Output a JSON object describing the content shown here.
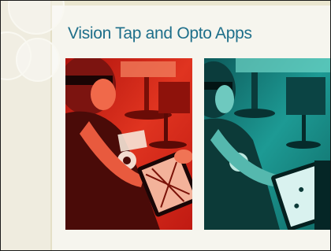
{
  "slide": {
    "title": "Vision Tap and Opto Apps"
  },
  "photos": [
    {
      "id": "left",
      "description_tint": "red"
    },
    {
      "id": "right",
      "description_tint": "teal"
    }
  ],
  "colors": {
    "title": "#1e6f8a",
    "background": "#f6f5ee",
    "left_rail": "#efecdf",
    "red_tint": "#d8231a",
    "teal_tint": "#168a8a"
  },
  "icons": [
    "decorative-circle-pattern"
  ]
}
